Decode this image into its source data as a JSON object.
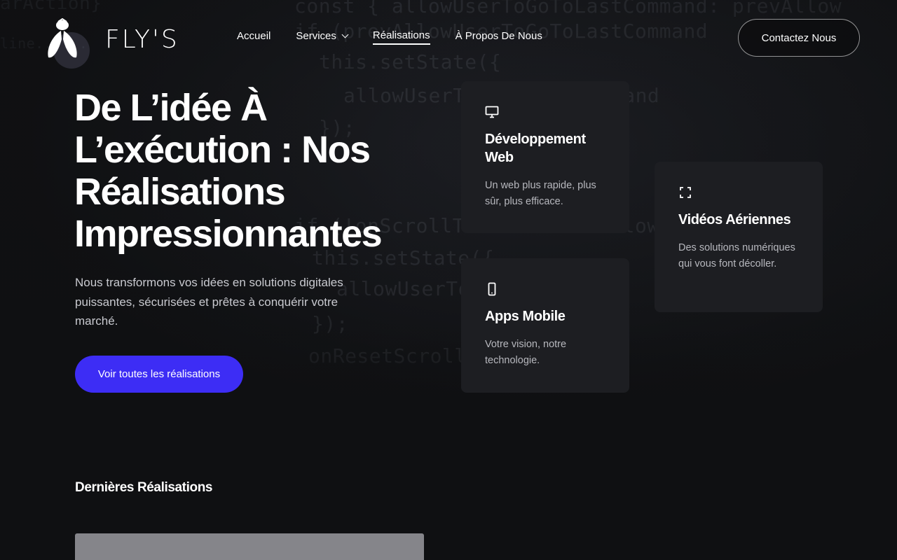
{
  "brand": {
    "name": "FLY'S"
  },
  "nav": {
    "items": [
      {
        "label": "Accueil"
      },
      {
        "label": "Services"
      },
      {
        "label": "Réalisations"
      },
      {
        "label": "À Propos De Nous"
      }
    ],
    "contact_label": "Contactez Nous"
  },
  "hero": {
    "title": "De L’idée À L’exécution : Nos Réalisations Impressionnantes",
    "subtitle": "Nous transformons vos idées en solutions digitales puissantes, sécurisées et prêtes à conquérir votre marché.",
    "cta_label": "Voir toutes les réalisations"
  },
  "cards": {
    "web": {
      "icon": "monitor-icon",
      "title": "Développement Web",
      "desc": "Un web plus rapide, plus sûr, plus efficace."
    },
    "mobile": {
      "icon": "smartphone-icon",
      "title": "Apps Mobile",
      "desc": "Votre vision, notre technologie."
    },
    "video": {
      "icon": "maximize-icon",
      "title": "Vidéos Aériennes",
      "desc": "Des solutions numériques qui vous font décoller."
    }
  },
  "latest": {
    "title": "Dernières Réalisations"
  },
  "colors": {
    "accent": "#3d2df5",
    "background": "#0f1012",
    "card": "#1d1e22"
  }
}
